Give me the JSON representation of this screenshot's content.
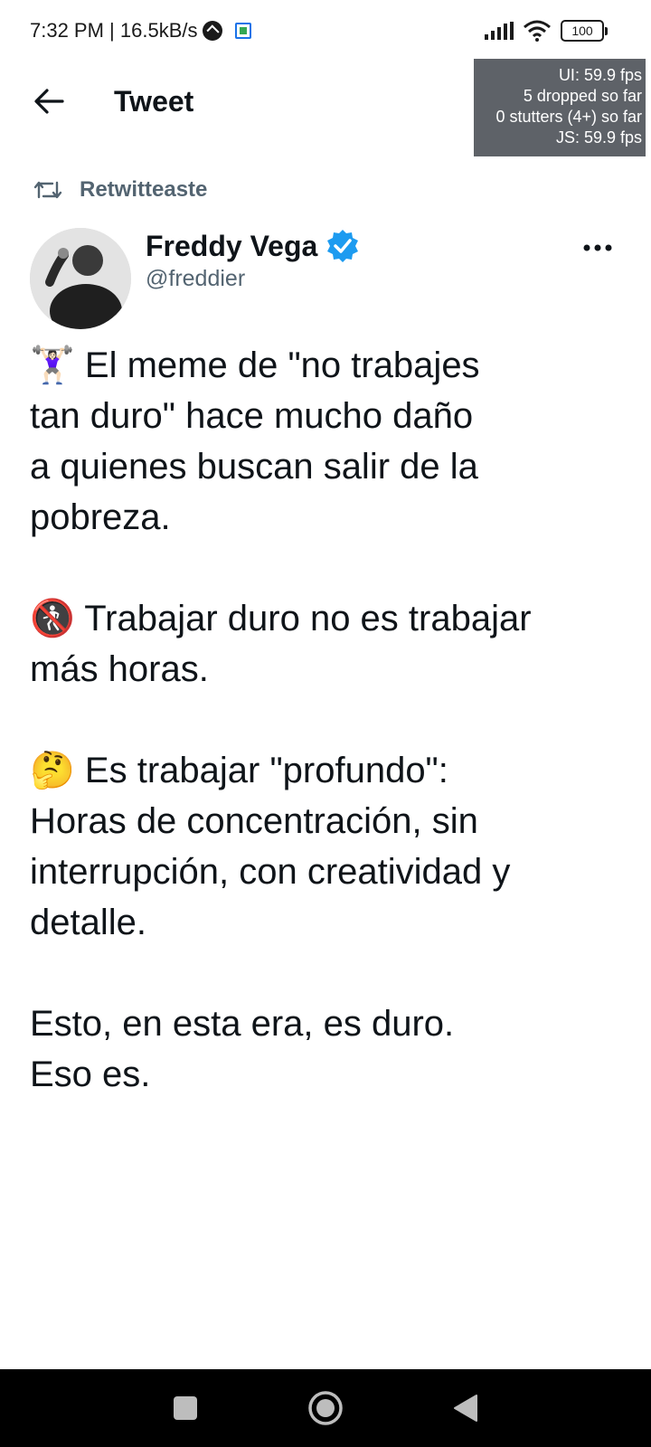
{
  "status_bar": {
    "time_speed": "7:32 PM | 16.5kB/s",
    "battery": "100"
  },
  "perf_overlay": {
    "ui_fps": "UI: 59.9 fps",
    "dropped": "5 dropped so far",
    "stutters": "0 stutters (4+) so far",
    "js_fps": "JS: 59.9 fps"
  },
  "header": {
    "title": "Tweet"
  },
  "retweet": {
    "label": "Retwitteaste"
  },
  "author": {
    "name": "Freddy Vega",
    "handle": "@freddier",
    "verified": true
  },
  "tweet": {
    "lines": [
      "🏋🏻‍♀️ El meme de \"no trabajes",
      "tan duro\" hace mucho daño",
      "a quienes buscan salir de la",
      "pobreza.",
      "",
      "🚷 Trabajar duro no es trabajar",
      "más horas.",
      "",
      "🤔 Es trabajar \"profundo\":",
      "Horas de concentración, sin",
      "interrupción, con creatividad y",
      "detalle.",
      "",
      "Esto, en esta era, es duro.",
      "Eso es."
    ]
  },
  "colors": {
    "verified": "#1d9bf0",
    "secondary_text": "#536471",
    "primary_text": "#0f1419"
  }
}
